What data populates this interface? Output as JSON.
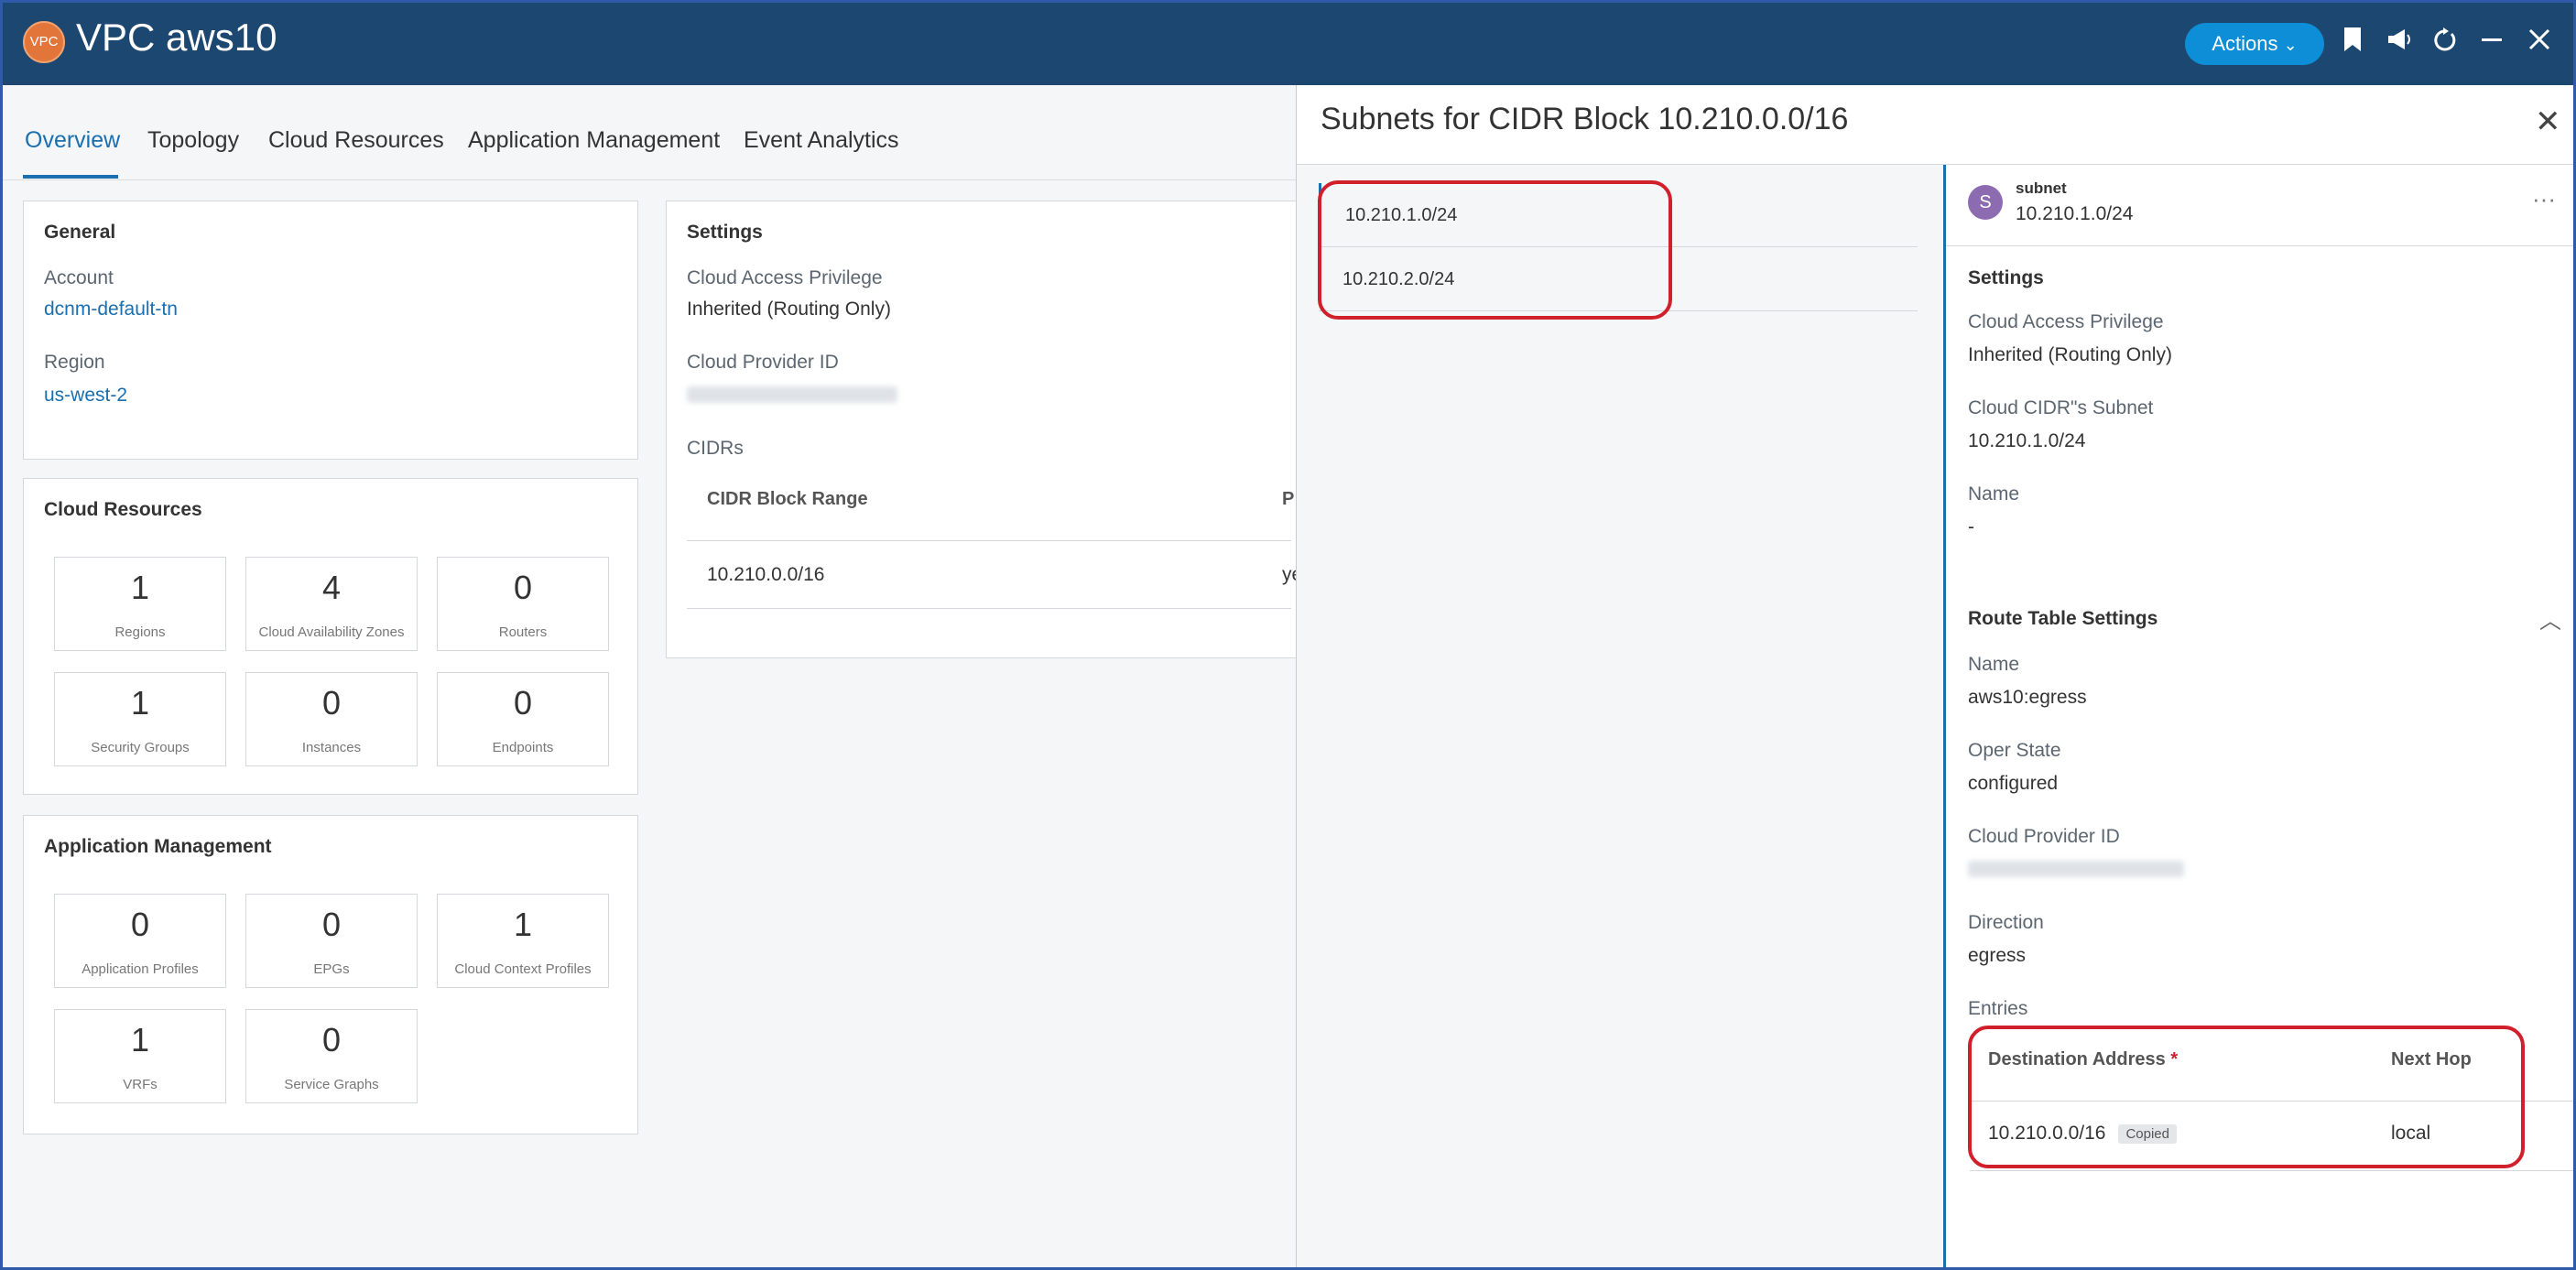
{
  "header": {
    "logo_text": "VPC",
    "title": "VPC aws10",
    "actions_label": "Actions",
    "actions_chevron": "⌄",
    "icons": [
      "bookmark-icon",
      "megaphone-icon",
      "refresh-icon",
      "minimize-icon",
      "close-icon"
    ],
    "icon_glyphs": {
      "bookmark": "🔖",
      "megaphone": "📢",
      "refresh": "↻",
      "minimize": "—",
      "close": "✕"
    }
  },
  "tabs": [
    {
      "label": "Overview",
      "active": true
    },
    {
      "label": "Topology",
      "active": false
    },
    {
      "label": "Cloud Resources",
      "active": false
    },
    {
      "label": "Application Management",
      "active": false
    },
    {
      "label": "Event Analytics",
      "active": false
    }
  ],
  "general": {
    "title": "General",
    "account_label": "Account",
    "account_value": "dcnm-default-tn",
    "region_label": "Region",
    "region_value": "us-west-2"
  },
  "cloud_resources": {
    "title": "Cloud Resources",
    "tiles": [
      {
        "value": "1",
        "label": "Regions"
      },
      {
        "value": "4",
        "label": "Cloud Availability Zones"
      },
      {
        "value": "0",
        "label": "Routers"
      },
      {
        "value": "1",
        "label": "Security Groups"
      },
      {
        "value": "0",
        "label": "Instances"
      },
      {
        "value": "0",
        "label": "Endpoints"
      }
    ]
  },
  "app_management": {
    "title": "Application Management",
    "tiles": [
      {
        "value": "0",
        "label": "Application Profiles"
      },
      {
        "value": "0",
        "label": "EPGs"
      },
      {
        "value": "1",
        "label": "Cloud Context Profiles"
      },
      {
        "value": "1",
        "label": "VRFs"
      },
      {
        "value": "0",
        "label": "Service Graphs"
      }
    ]
  },
  "settings": {
    "title": "Settings",
    "access_label": "Cloud Access Privilege",
    "access_value": "Inherited (Routing Only)",
    "provider_id_label": "Cloud Provider ID",
    "cidrs_label": "CIDRs",
    "table_headers": [
      "CIDR Block Range",
      "P"
    ],
    "rows": [
      {
        "cidr": "10.210.0.0/16",
        "primary": "ye"
      }
    ]
  },
  "panel": {
    "title": "Subnets for CIDR Block 10.210.0.0/16",
    "close_glyph": "✕",
    "subnets": [
      "10.210.1.0/24",
      "10.210.2.0/24"
    ],
    "detail": {
      "avatar": "S",
      "type": "subnet",
      "name": "10.210.1.0/24",
      "more_glyph": "···",
      "settings_title": "Settings",
      "access_label": "Cloud Access Privilege",
      "access_value": "Inherited (Routing Only)",
      "cidr_subnet_label": "Cloud CIDR\"s Subnet",
      "cidr_subnet_value": "10.210.1.0/24",
      "name_label": "Name",
      "name_value": "-",
      "route_title": "Route Table Settings",
      "collapse_glyph": "︿",
      "rt_name_label": "Name",
      "rt_name_value": "aws10:egress",
      "oper_label": "Oper State",
      "oper_value": "configured",
      "provider_id_label": "Cloud Provider ID",
      "direction_label": "Direction",
      "direction_value": "egress",
      "entries_label": "Entries",
      "entries_headers": {
        "dest": "Destination Address",
        "required": "*",
        "hop": "Next Hop"
      },
      "entries": [
        {
          "dest": "10.210.0.0/16",
          "badge": "Copied",
          "hop": "local"
        }
      ]
    }
  },
  "colors": {
    "header_bg": "#1c4770",
    "accent": "#1a6fb0",
    "actions_bg": "#0d8ed6",
    "highlight": "#d0202c"
  }
}
